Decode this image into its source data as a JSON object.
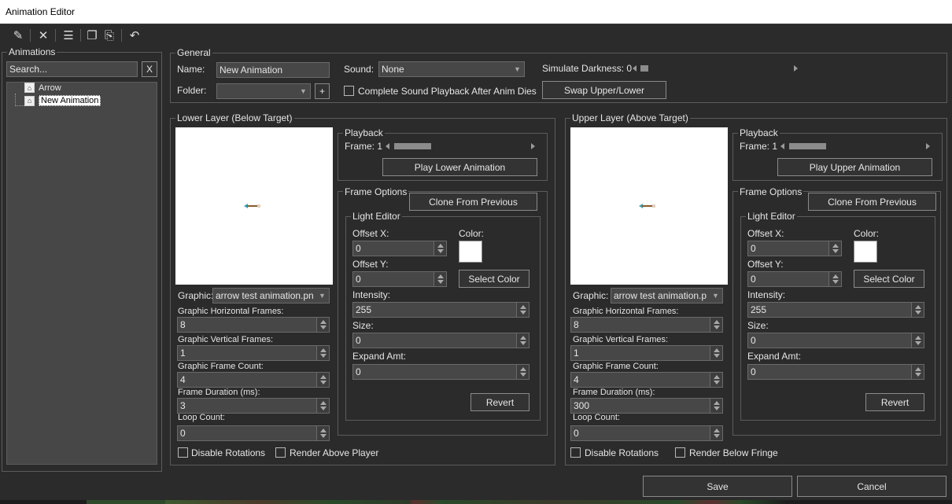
{
  "window": {
    "title": "Animation Editor"
  },
  "toolbar": {
    "buttons": [
      {
        "name": "new-icon",
        "glyph": "✎"
      },
      {
        "name": "delete-icon",
        "glyph": "✕"
      },
      {
        "name": "properties-icon",
        "glyph": "☰"
      },
      {
        "name": "copy-icon",
        "glyph": "❐"
      },
      {
        "name": "paste-icon",
        "glyph": "⎘"
      },
      {
        "name": "undo-icon",
        "glyph": "↶"
      }
    ]
  },
  "animations": {
    "label": "Animations",
    "search_placeholder": "Search...",
    "clear_label": "X",
    "items": [
      {
        "label": "Arrow"
      },
      {
        "label": "New Animation"
      }
    ]
  },
  "general": {
    "label": "General",
    "name_label": "Name:",
    "name_value": "New Animation",
    "sound_label": "Sound:",
    "sound_value": "None",
    "simulate_darkness_label": "Simulate Darkness: 0",
    "folder_label": "Folder:",
    "folder_value": "",
    "add_folder_label": "+",
    "complete_sound_label": "Complete Sound Playback After Anim Dies",
    "swap_label": "Swap Upper/Lower"
  },
  "lower": {
    "label": "Lower Layer (Below Target)",
    "playback_label": "Playback",
    "frame_label": "Frame: 1",
    "play_label": "Play Lower Animation",
    "frame_options_label": "Frame Options",
    "clone_label": "Clone From Previous",
    "light_editor_label": "Light Editor",
    "offset_x_label": "Offset X:",
    "offset_x_value": "0",
    "offset_y_label": "Offset Y:",
    "offset_y_value": "0",
    "color_label": "Color:",
    "select_color_label": "Select Color",
    "intensity_label": "Intensity:",
    "intensity_value": "255",
    "size_label": "Size:",
    "size_value": "0",
    "expand_label": "Expand Amt:",
    "expand_value": "0",
    "revert_label": "Revert",
    "graphic_label": "Graphic:",
    "graphic_value": "arrow test animation.pn",
    "hframes_label": "Graphic Horizontal Frames:",
    "hframes_value": "8",
    "vframes_label": "Graphic Vertical Frames:",
    "vframes_value": "1",
    "frame_count_label": "Graphic Frame Count:",
    "frame_count_value": "4",
    "duration_label": "Frame Duration (ms):",
    "duration_value": "3",
    "loop_label": "Loop Count:",
    "loop_value": "0",
    "disable_rotations_label": "Disable Rotations",
    "extra_check_label": "Render Above Player"
  },
  "upper": {
    "label": "Upper Layer (Above Target)",
    "playback_label": "Playback",
    "frame_label": "Frame: 1",
    "play_label": "Play Upper Animation",
    "frame_options_label": "Frame Options",
    "clone_label": "Clone From Previous",
    "light_editor_label": "Light Editor",
    "offset_x_label": "Offset X:",
    "offset_x_value": "0",
    "offset_y_label": "Offset Y:",
    "offset_y_value": "0",
    "color_label": "Color:",
    "select_color_label": "Select Color",
    "intensity_label": "Intensity:",
    "intensity_value": "255",
    "size_label": "Size:",
    "size_value": "0",
    "expand_label": "Expand Amt:",
    "expand_value": "0",
    "revert_label": "Revert",
    "graphic_label": "Graphic:",
    "graphic_value": "arrow test animation.p",
    "hframes_label": "Graphic Horizontal Frames:",
    "hframes_value": "8",
    "vframes_label": "Graphic Vertical Frames:",
    "vframes_value": "1",
    "frame_count_label": "Graphic Frame Count:",
    "frame_count_value": "4",
    "duration_label": "Frame Duration (ms):",
    "duration_value": "300",
    "loop_label": "Loop Count:",
    "loop_value": "0",
    "disable_rotations_label": "Disable Rotations",
    "extra_check_label": "Render Below Fringe"
  },
  "footer": {
    "save_label": "Save",
    "cancel_label": "Cancel"
  },
  "colors": {
    "background": "#2b2b2b",
    "input": "#474747",
    "light_color": "#ffffff"
  }
}
